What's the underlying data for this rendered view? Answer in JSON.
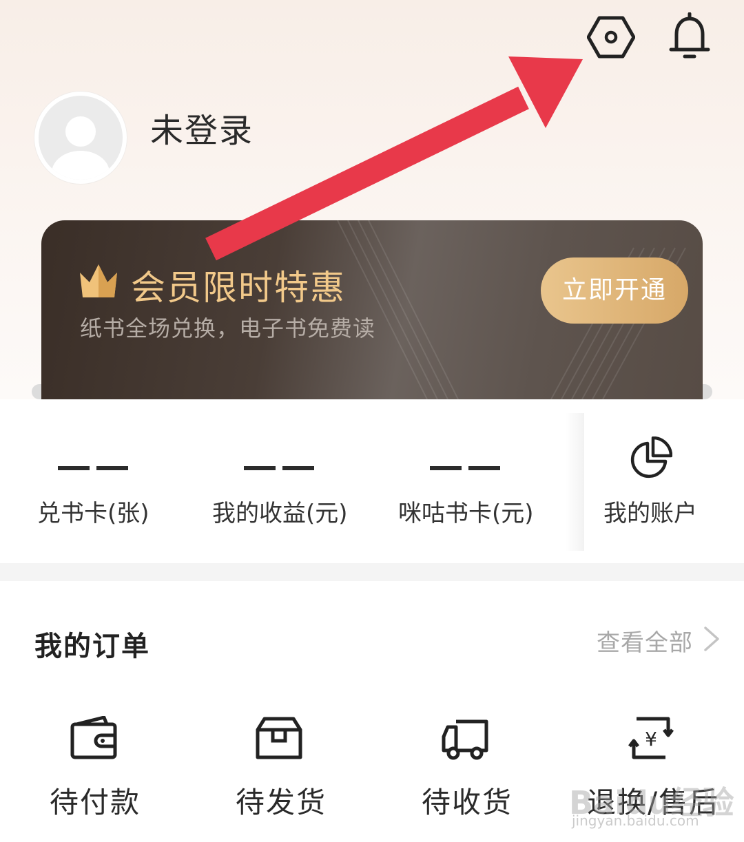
{
  "header": {
    "settings_icon": "settings-hexagon-icon",
    "bell_icon": "bell-icon"
  },
  "profile": {
    "username": "未登录",
    "avatar_icon": "default-avatar-icon"
  },
  "vip": {
    "title": "会员限时特惠",
    "subtitle": "纸书全场兑换，电子书免费读",
    "button_label": "立即开通",
    "crown_icon": "crown-icon",
    "title_color": "#f2c98a",
    "button_color": "#d7a868"
  },
  "stats": [
    {
      "value": "— —",
      "label": "兑书卡(张)"
    },
    {
      "value": "— —",
      "label": "我的收益(元)"
    },
    {
      "value": "— —",
      "label": "咪咕书卡(元)"
    }
  ],
  "account": {
    "label": "我的账户",
    "icon": "pie-chart-icon"
  },
  "orders": {
    "title": "我的订单",
    "view_all": "查看全部",
    "items": [
      {
        "label": "待付款",
        "icon": "wallet-icon"
      },
      {
        "label": "待发货",
        "icon": "package-box-icon"
      },
      {
        "label": "待收货",
        "icon": "delivery-truck-icon"
      },
      {
        "label": "退换/售后",
        "icon": "refund-yen-icon"
      }
    ]
  },
  "annotation": {
    "arrow_color": "#e8394a"
  },
  "watermark": {
    "text": "Baidu经验",
    "url_text": "jingyan.baidu.com"
  }
}
